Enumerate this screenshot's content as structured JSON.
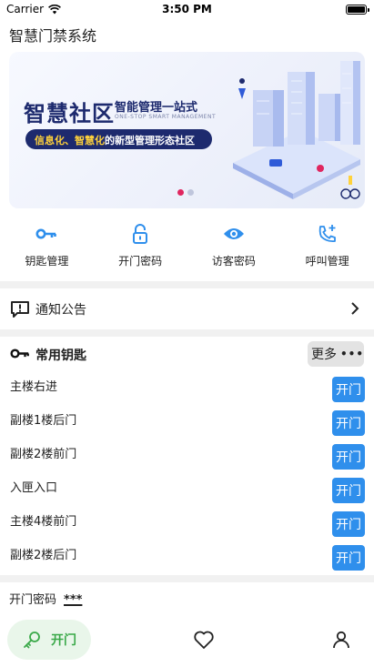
{
  "status_bar": {
    "carrier": "Carrier",
    "time": "3:50 PM"
  },
  "app": {
    "title": "智慧门禁系统"
  },
  "banner": {
    "headline": "智慧社区",
    "subheadline": "智能管理一站式",
    "english_tagline": "ONE-STOP SMART MANAGEMENT",
    "slogan_highlight": "信息化、智慧化",
    "slogan_rest": "的新型管理形态社区",
    "active_dot_color": "#e0265f",
    "inactive_dot_color": "#bfc6dc"
  },
  "features": [
    {
      "label": "钥匙管理",
      "icon": "key-icon"
    },
    {
      "label": "开门密码",
      "icon": "unlock-icon"
    },
    {
      "label": "访客密码",
      "icon": "eye-icon"
    },
    {
      "label": "呼叫管理",
      "icon": "phone-add-icon"
    }
  ],
  "notice": {
    "label": "通知公告",
    "icon": "notice-icon"
  },
  "common_keys": {
    "title": "常用钥匙",
    "more_label": "更多",
    "open_label": "开门",
    "items": [
      {
        "name": "主楼右进"
      },
      {
        "name": "副楼1楼后门"
      },
      {
        "name": "副楼2楼前门"
      },
      {
        "name": "入匣入口"
      },
      {
        "name": "主楼4楼前门"
      },
      {
        "name": "副楼2楼后门"
      }
    ]
  },
  "open_password": {
    "label": "开门密码",
    "value": "***"
  },
  "tab_bar": {
    "active_label": "开门",
    "active_color": "#3aa949",
    "tabs": [
      "open-door-tab",
      "favorites-tab",
      "profile-tab"
    ]
  },
  "colors": {
    "accent": "#2f8fec",
    "navy": "#1d2a6e"
  }
}
